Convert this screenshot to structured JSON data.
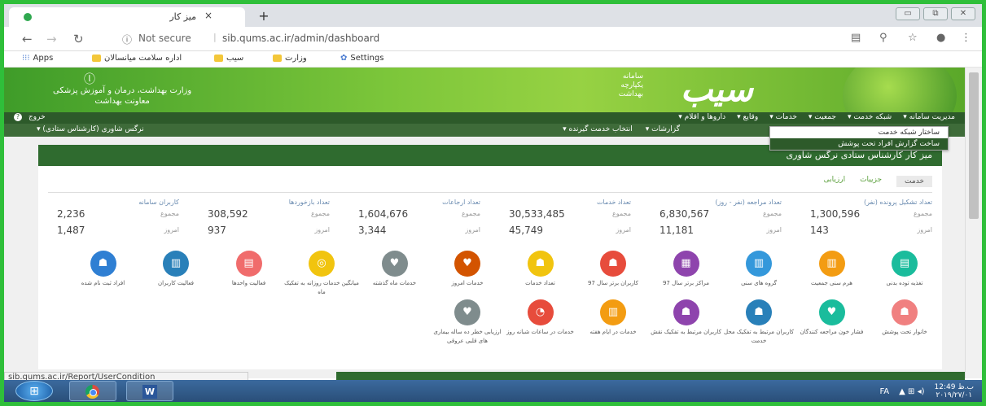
{
  "browser": {
    "tab_title": "میز کار",
    "tab_close": "×",
    "new_tab": "+",
    "url_info": "ⓘ",
    "not_secure": "Not secure",
    "url": "sib.qums.ac.ir/admin/dashboard",
    "window_controls": [
      "▭",
      "⧉",
      "✕"
    ]
  },
  "bookmarks": [
    {
      "label": "Apps"
    },
    {
      "label": "اداره سلامت میانسالان"
    },
    {
      "label": "سیب"
    },
    {
      "label": "وزارت"
    },
    {
      "label": "Settings"
    }
  ],
  "banner": {
    "emblem": "ⓛ",
    "ministry_line1": "وزارت بهداشت، درمان و آموزش پزشکی",
    "ministry_line2": "معاونت بهداشت",
    "sub_line1": "سامانه",
    "sub_line2": "یکپارچه",
    "sub_line3": "بهداشت",
    "brand": "سیب"
  },
  "menu": {
    "items": [
      "مدیریت سامانه ▾",
      "شبکه خدمت ▾",
      "جمعیت ▾",
      "خدمات ▾",
      "وقایع ▾",
      "داروها و اقلام ▾"
    ],
    "exit": "خروج",
    "help": "?",
    "role": "نرگس شاوری (کارشناس ستادی) ▾",
    "sub_items": [
      "گزارشات ▾",
      "انتخاب خدمت گیرنده ▾"
    ]
  },
  "dropdown": {
    "items": [
      "ساختار شبکه خدمت",
      "ساخت گزارش افراد تحت پوشش"
    ]
  },
  "panel": {
    "title": "میز کار کارشناس ستادی نرگس شاوری",
    "tabs": [
      "خدمت",
      "جزییات",
      "ارزیابی"
    ]
  },
  "stats": [
    {
      "label": "تعداد تشکیل پرونده (نفر)",
      "total_label": "مجموع",
      "total": "1,300,596",
      "today_label": "امروز",
      "today": "143"
    },
    {
      "label": "تعداد مراجعه (نفر - روز)",
      "total_label": "مجموع",
      "total": "6,830,567",
      "today_label": "امروز",
      "today": "11,181"
    },
    {
      "label": "تعداد خدمات",
      "total_label": "مجموع",
      "total": "30,533,485",
      "today_label": "امروز",
      "today": "45,749"
    },
    {
      "label": "تعداد ارجاعات",
      "total_label": "مجموع",
      "total": "1,604,676",
      "today_label": "امروز",
      "today": "3,344"
    },
    {
      "label": "تعداد بازخوردها",
      "total_label": "مجموع",
      "total": "308,592",
      "today_label": "امروز",
      "today": "937"
    },
    {
      "label": "کاربران سامانه",
      "total_label": "مجموع",
      "total": "2,236",
      "today_label": "امروز",
      "today": "1,487"
    }
  ],
  "tiles_row1": [
    {
      "label": "تغذیه توده بدنی",
      "color": "#1abc9c",
      "icon": "▤"
    },
    {
      "label": "هرم سنی جمعیت",
      "color": "#f39c12",
      "icon": "▥"
    },
    {
      "label": "گروه های سنی",
      "color": "#3498db",
      "icon": "▥"
    },
    {
      "label": "مراکز برتر سال 97",
      "color": "#8e44ad",
      "icon": "▦"
    },
    {
      "label": "کاربران برتر سال 97",
      "color": "#e74c3c",
      "icon": "☗"
    },
    {
      "label": "تعداد خدمات",
      "color": "#f1c40f",
      "icon": "☗"
    },
    {
      "label": "خدمات امروز",
      "color": "#d35400",
      "icon": "♥"
    },
    {
      "label": "خدمات ماه گذشته",
      "color": "#7f8c8d",
      "icon": "♥"
    },
    {
      "label": "میانگین خدمات روزانه به تفکیک ماه",
      "color": "#f1c40f",
      "icon": "◎"
    },
    {
      "label": "فعالیت واحدها",
      "color": "#f06c6c",
      "icon": "▤"
    },
    {
      "label": "فعالیت کاربران",
      "color": "#2980b9",
      "icon": "▥"
    },
    {
      "label": "افراد ثبت نام شده",
      "color": "#2f7fd3",
      "icon": "☗"
    }
  ],
  "tiles_row2": [
    {
      "label": "خانوار تحت پوشش",
      "color": "#f08080",
      "icon": "☗"
    },
    {
      "label": "فشار خون مراجعه کنندگان",
      "color": "#1abc9c",
      "icon": "♥"
    },
    {
      "label": "کاربران مرتبط به تفکیک محل خدمت",
      "color": "#2980b9",
      "icon": "☗"
    },
    {
      "label": "کاربران مرتبط به تفکیک نقش",
      "color": "#8e44ad",
      "icon": "☗"
    },
    {
      "label": "خدمات در ایام هفته",
      "color": "#f39c12",
      "icon": "▥"
    },
    {
      "label": "خدمات در ساعات شبانه روز",
      "color": "#e74c3c",
      "icon": "◔"
    },
    {
      "label": "ارزیابی خطر ده ساله بیماری های قلبی عروقی",
      "color": "#7f8c8d",
      "icon": "♥"
    }
  ],
  "status": {
    "url": "sib.qums.ac.ir/Report/UserCondition"
  },
  "taskbar": {
    "start": "⊞",
    "word": "W",
    "lang": "FA",
    "tray_icons": "▲  ⊞  ◂)",
    "time": "12:49 ب.ظ",
    "date": "۲۰۱۹/۲۷/۰۱"
  },
  "colors": {
    "frame_green": "#2fbf3a",
    "menu_dark": "#2d5a2a",
    "panel_green": "#2f6b2f"
  }
}
